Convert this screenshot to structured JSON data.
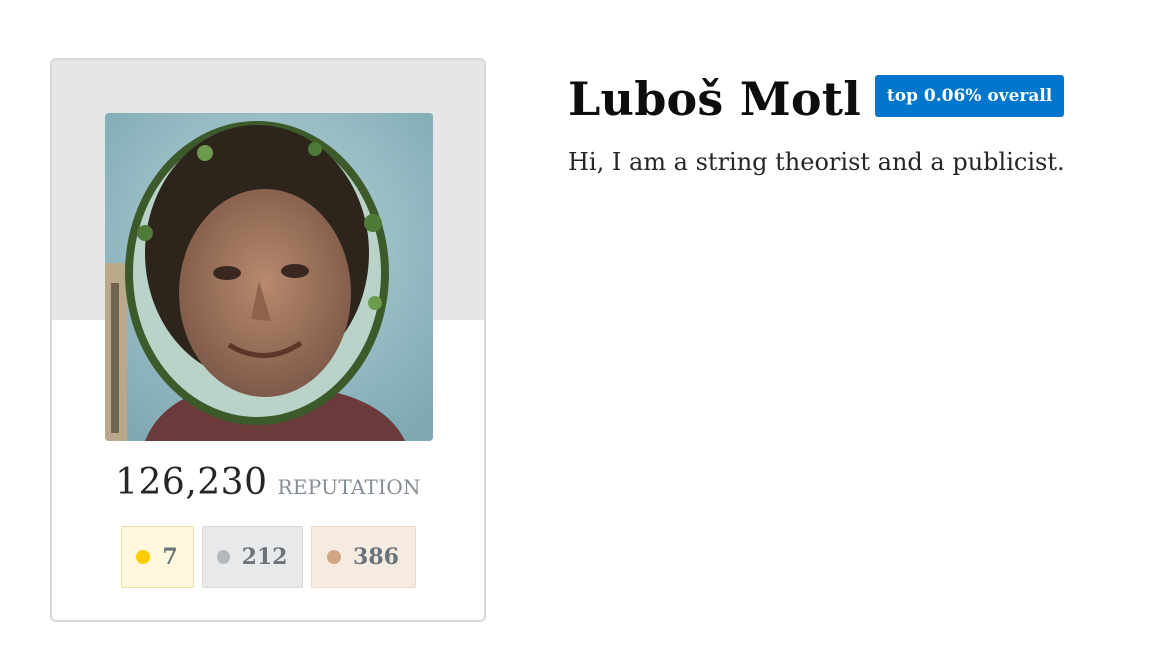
{
  "profile": {
    "name": "Luboš Motl",
    "rank_badge": "top 0.06% overall",
    "bio": "Hi, I am a string theorist and a publicist.",
    "reputation_value": "126,230",
    "reputation_label": "REPUTATION"
  },
  "badges": {
    "gold": {
      "count": "7",
      "color": "#ffcc01"
    },
    "silver": {
      "count": "212",
      "color": "#b4b8bc"
    },
    "bronze": {
      "count": "386",
      "color": "#d1a684"
    }
  },
  "colors": {
    "accent": "#0077cc",
    "card_header": "#e4e6e8"
  },
  "avatar": {
    "icon": "user-avatar-photo"
  }
}
